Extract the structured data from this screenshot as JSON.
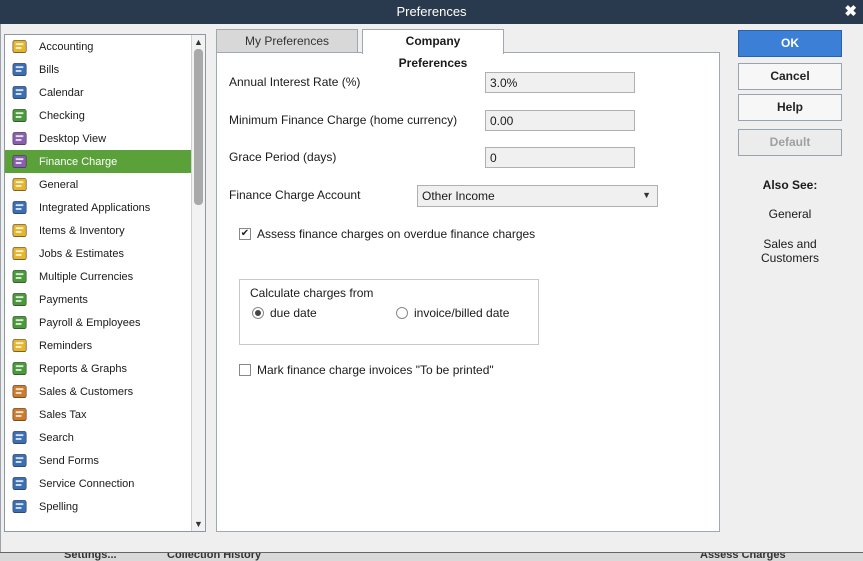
{
  "window": {
    "title": "Preferences",
    "close_glyph": "✖"
  },
  "sidebar": {
    "items": [
      {
        "label": "Accounting",
        "icon": "accounting-icon",
        "color": "#e8b62c"
      },
      {
        "label": "Bills",
        "icon": "bills-icon",
        "color": "#3a6fb6"
      },
      {
        "label": "Calendar",
        "icon": "calendar-icon",
        "color": "#3a6fb6"
      },
      {
        "label": "Checking",
        "icon": "checking-icon",
        "color": "#4a9a3a"
      },
      {
        "label": "Desktop View",
        "icon": "desktop-view-icon",
        "color": "#8a5fb0"
      },
      {
        "label": "Finance Charge",
        "icon": "finance-charge-icon",
        "color": "#8a5fb0"
      },
      {
        "label": "General",
        "icon": "general-icon",
        "color": "#e8b62c"
      },
      {
        "label": "Integrated Applications",
        "icon": "integrated-apps-icon",
        "color": "#3a6fb6"
      },
      {
        "label": "Items & Inventory",
        "icon": "items-inventory-icon",
        "color": "#e8b62c"
      },
      {
        "label": "Jobs & Estimates",
        "icon": "jobs-estimates-icon",
        "color": "#e8b62c"
      },
      {
        "label": "Multiple Currencies",
        "icon": "multiple-currencies-icon",
        "color": "#4a9a3a"
      },
      {
        "label": "Payments",
        "icon": "payments-icon",
        "color": "#4a9a3a"
      },
      {
        "label": "Payroll & Employees",
        "icon": "payroll-employees-icon",
        "color": "#4a9a3a"
      },
      {
        "label": "Reminders",
        "icon": "reminders-icon",
        "color": "#e8b62c"
      },
      {
        "label": "Reports & Graphs",
        "icon": "reports-graphs-icon",
        "color": "#4a9a3a"
      },
      {
        "label": "Sales & Customers",
        "icon": "sales-customers-icon",
        "color": "#d07a2a"
      },
      {
        "label": "Sales Tax",
        "icon": "sales-tax-icon",
        "color": "#d07a2a"
      },
      {
        "label": "Search",
        "icon": "search-icon",
        "color": "#3a6fb6"
      },
      {
        "label": "Send Forms",
        "icon": "send-forms-icon",
        "color": "#3a6fb6"
      },
      {
        "label": "Service Connection",
        "icon": "service-connection-icon",
        "color": "#3a6fb6"
      },
      {
        "label": "Spelling",
        "icon": "spelling-icon",
        "color": "#3a6fb6"
      }
    ],
    "selected_index": 5,
    "selected_color": "#5ba13a"
  },
  "tabs": {
    "my_preferences": "My Preferences",
    "company_preferences": "Company Preferences"
  },
  "form": {
    "interest_rate_label": "Annual Interest Rate (%)",
    "interest_rate_value": "3.0%",
    "min_charge_label": "Minimum Finance Charge (home currency)",
    "min_charge_value": "0.00",
    "grace_label": "Grace Period (days)",
    "grace_value": "0",
    "account_label": "Finance Charge Account",
    "account_value": "Other Income",
    "assess_label": "Assess finance charges on overdue finance charges",
    "assess_checked": true,
    "calc_title": "Calculate charges from",
    "radio_due": "due date",
    "radio_invoice": "invoice/billed date",
    "radio_selected": "due date",
    "mark_label": "Mark finance charge invoices \"To be printed\"",
    "mark_checked": false
  },
  "buttons": {
    "ok": "OK",
    "cancel": "Cancel",
    "help": "Help",
    "default": "Default"
  },
  "also_see": {
    "title": "Also See:",
    "general": "General",
    "sales_customers": "Sales and Customers"
  },
  "background_strip": {
    "settings": "Settings...",
    "collection_history": "Collection History",
    "assess_charges": "Assess Charges"
  }
}
